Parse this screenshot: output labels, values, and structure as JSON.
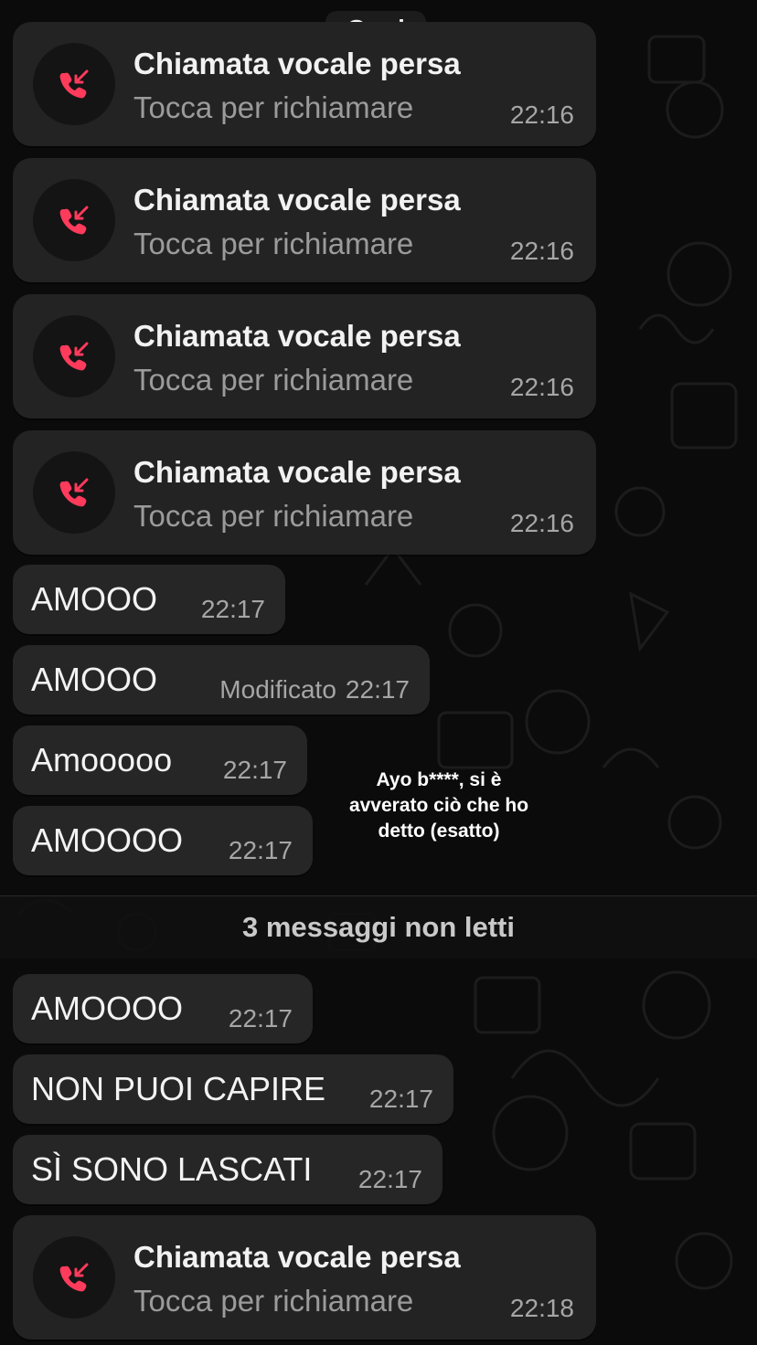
{
  "date_chip": "Oggi",
  "missed_calls": [
    {
      "title": "Chiamata vocale persa",
      "subtitle": "Tocca per richiamare",
      "time": "22:16"
    },
    {
      "title": "Chiamata vocale persa",
      "subtitle": "Tocca per richiamare",
      "time": "22:16"
    },
    {
      "title": "Chiamata vocale persa",
      "subtitle": "Tocca per richiamare",
      "time": "22:16"
    },
    {
      "title": "Chiamata vocale persa",
      "subtitle": "Tocca per richiamare",
      "time": "22:16"
    },
    {
      "title": "Chiamata vocale persa",
      "subtitle": "Tocca per richiamare",
      "time": "22:18"
    }
  ],
  "messages": [
    {
      "text": "AMOOO",
      "time": "22:17",
      "edited": ""
    },
    {
      "text": "AMOOO",
      "time": "22:17",
      "edited": "Modificato"
    },
    {
      "text": "Amooooo",
      "time": "22:17",
      "edited": ""
    },
    {
      "text": "AMOOOO",
      "time": "22:17",
      "edited": ""
    },
    {
      "text": "AMOOOO",
      "time": "22:17",
      "edited": ""
    },
    {
      "text": "NON PUOI CAPIRE",
      "time": "22:17",
      "edited": ""
    },
    {
      "text": "SÌ SONO LASCATI",
      "time": "22:17",
      "edited": ""
    }
  ],
  "unread_divider": "3 messaggi non letti",
  "caption": "Ayo b****, si è avverato ciò che ho detto (esatto)",
  "colors": {
    "background": "#0b0b0b",
    "bubble": "#262626",
    "missed_call_icon": "#ff3b5c"
  },
  "icons": {
    "missed_call": "missed-call-icon"
  }
}
